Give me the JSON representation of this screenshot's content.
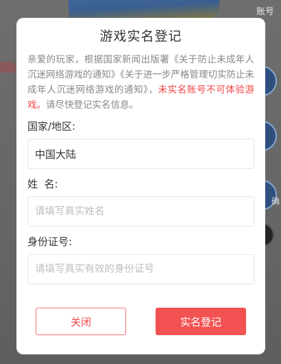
{
  "background": {
    "account_label": "账号",
    "side_label": "确"
  },
  "dialog": {
    "title": "游戏实名登记",
    "notice_main": "亲爱的玩家，根据国家新闻出版署《关于防止未成年人沉迷网络游戏的通知》《关于进一步严格管理切实防止未成年人沉迷网络游戏的通知》，",
    "notice_warning": "未实名账号不可体验游戏。",
    "notice_tail": "请尽快登记实名信息。",
    "region_label": "国家/地区:",
    "region_value": "中国大陆",
    "name_label": "姓  名:",
    "name_placeholder": "请填写真实姓名",
    "id_label": "身份证号:",
    "id_placeholder": "请填写真实有效的身份证号",
    "close_label": "关闭",
    "submit_label": "实名登记"
  },
  "colors": {
    "accent": "#f25252",
    "warning_text": "#f04545"
  }
}
